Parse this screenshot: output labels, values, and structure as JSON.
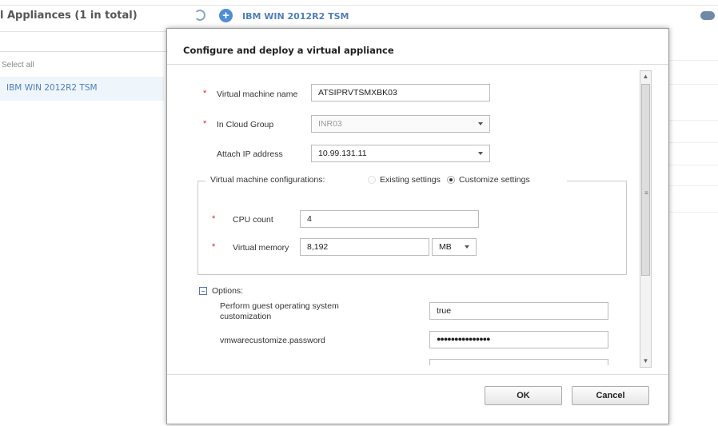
{
  "background": {
    "list_title": "l Appliances (1 in total)",
    "select_all": "Select all",
    "list_item": "IBM WIN 2012R2 TSM",
    "breadcrumb": "IBM WIN 2012R2 TSM"
  },
  "dialog": {
    "title": "Configure and deploy a virtual appliance",
    "required_marker": "*",
    "vm_name_label": "Virtual machine name",
    "vm_name_value": "ATSIPRVTSMXBK03",
    "cloud_group_label": "In Cloud Group",
    "cloud_group_value": "INR03",
    "ip_label": "Attach IP address",
    "ip_value": "10.99.131.11",
    "config_label": "Virtual machine configurations:",
    "existing_settings": "Existing settings",
    "customize_settings": "Customize settings",
    "cpu_label": "CPU count",
    "cpu_value": "4",
    "memory_label": "Virtual memory",
    "memory_value": "8,192",
    "memory_unit": "MB",
    "options_label": "Options:",
    "guest_custom_label": "Perform guest operating system customization",
    "guest_custom_value": "true",
    "password_label": "vmwarecustomize.password",
    "password_value": "●●●●●●●●●●●●●●●",
    "ok": "OK",
    "cancel": "Cancel"
  },
  "colors": {
    "accent": "#4d8fd1",
    "link": "#4f7fb5",
    "required": "#dd2222"
  }
}
